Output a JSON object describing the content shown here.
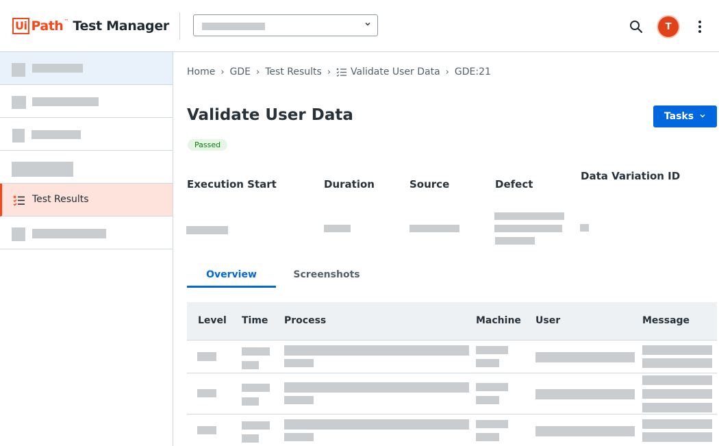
{
  "header": {
    "logo_brand_ui": "Ui",
    "logo_brand_path": "Path",
    "logo_tm": "™",
    "logo_product": "Test Manager",
    "avatar_initial": "T"
  },
  "sidebar": {
    "active_item_label": "Test Results"
  },
  "breadcrumb": {
    "items": [
      "Home",
      "GDE",
      "Test Results",
      "Validate User Data",
      "GDE:21"
    ]
  },
  "page": {
    "title": "Validate User Data",
    "status": "Passed",
    "tasks_label": "Tasks"
  },
  "details": {
    "headers": [
      "Execution Start",
      "Duration",
      "Source",
      "Defect",
      "Data Variation ID"
    ]
  },
  "tabs": [
    {
      "label": "Overview",
      "active": true
    },
    {
      "label": "Screenshots",
      "active": false
    }
  ],
  "table": {
    "columns": [
      "Level",
      "Time",
      "Process",
      "Machine",
      "User",
      "Message"
    ]
  },
  "colors": {
    "accent": "#0067df",
    "brand": "#fa4616",
    "active_nav_bg": "#fde3dc",
    "status_passed": "#038108"
  }
}
